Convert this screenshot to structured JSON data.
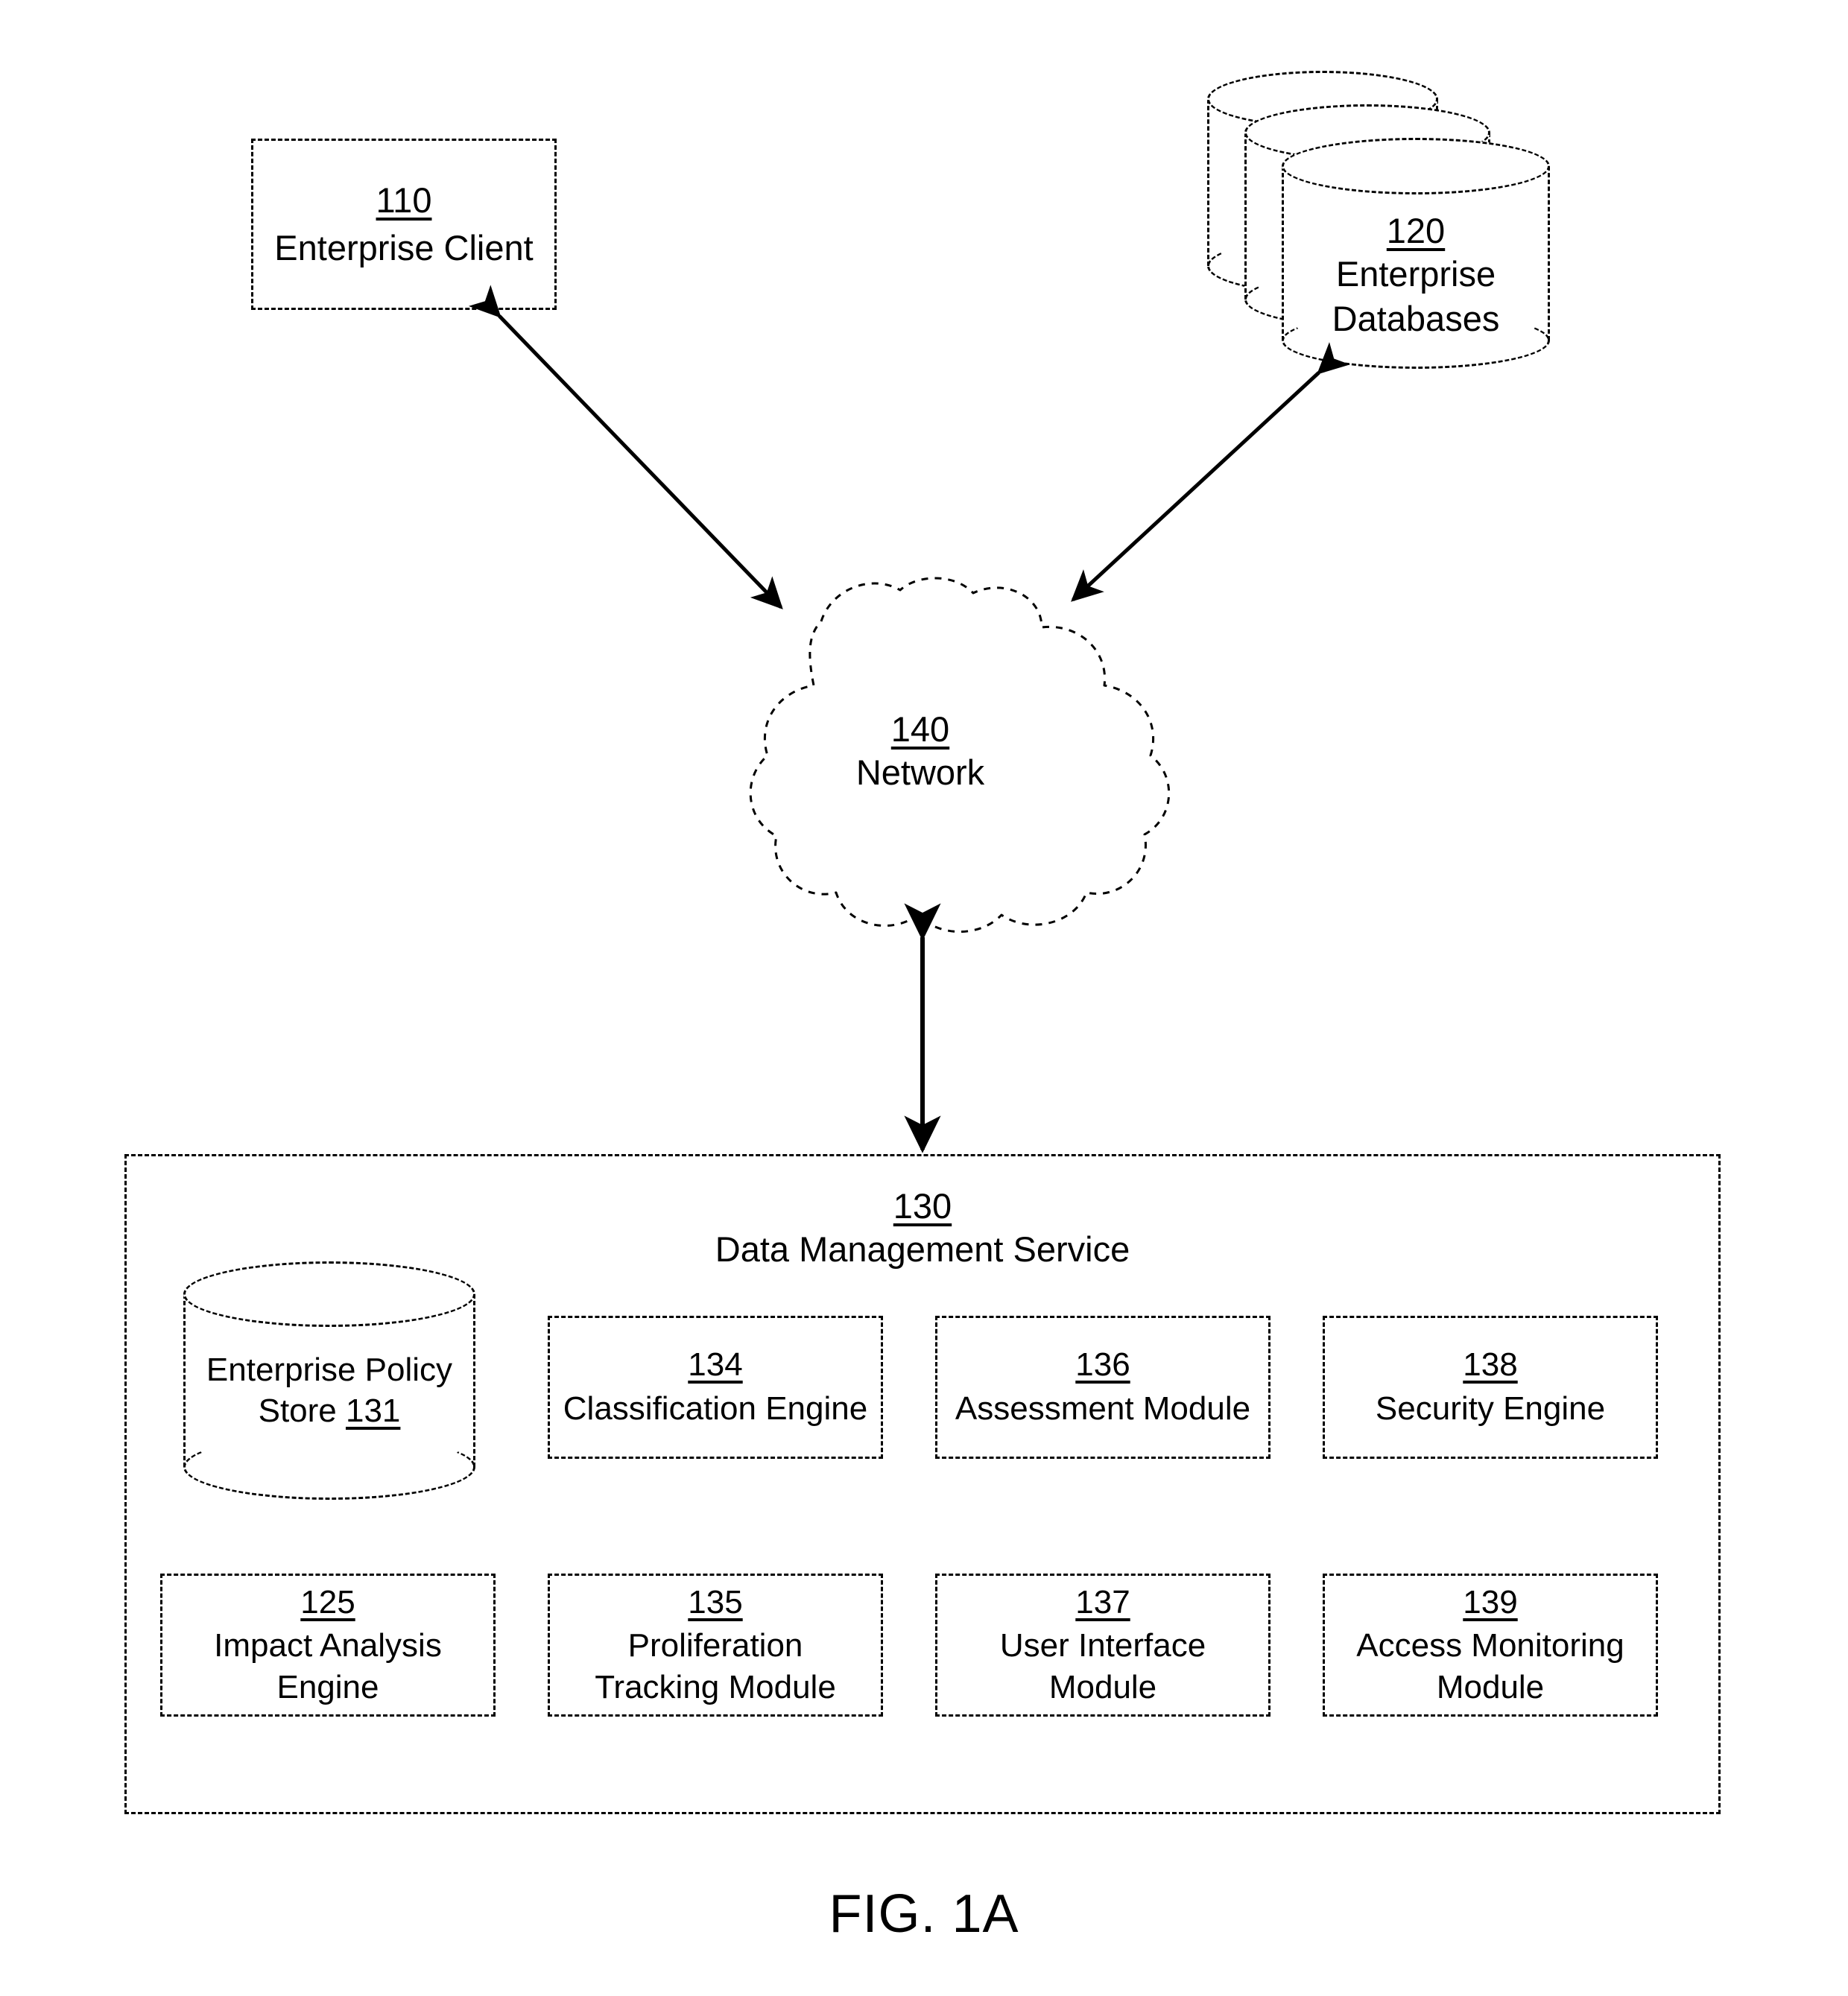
{
  "figure": {
    "caption": "FIG. 1A"
  },
  "client": {
    "ref": "110",
    "label": "Enterprise Client"
  },
  "databases": {
    "ref": "120",
    "label_line1": "Enterprise",
    "label_line2": "Databases",
    "cylinder_count": 3
  },
  "network": {
    "ref": "140",
    "label": "Network"
  },
  "service": {
    "ref": "130",
    "label": "Data Management Service",
    "policy_store": {
      "label_line1": "Enterprise Policy",
      "label_line2_text": "Store ",
      "ref": "131"
    },
    "modules_row1": [
      {
        "ref": "134",
        "label_line1": "Classification Engine",
        "label_line2": ""
      },
      {
        "ref": "136",
        "label_line1": "Assessment Module",
        "label_line2": ""
      },
      {
        "ref": "138",
        "label_line1": "Security Engine",
        "label_line2": ""
      }
    ],
    "modules_row2": [
      {
        "ref": "125",
        "label_line1": "Impact Analysis",
        "label_line2": "Engine"
      },
      {
        "ref": "135",
        "label_line1": "Proliferation",
        "label_line2": "Tracking Module"
      },
      {
        "ref": "137",
        "label_line1": "User Interface",
        "label_line2": "Module"
      },
      {
        "ref": "139",
        "label_line1": "Access Monitoring",
        "label_line2": "Module"
      }
    ]
  },
  "connections": [
    {
      "name": "client-network",
      "from": "110",
      "to": "140",
      "style": "double-arrow"
    },
    {
      "name": "databases-network",
      "from": "120",
      "to": "140",
      "style": "double-arrow"
    },
    {
      "name": "network-service",
      "from": "140",
      "to": "130",
      "style": "double-arrow"
    }
  ],
  "colors": {
    "line": "#000000",
    "background": "#ffffff"
  }
}
